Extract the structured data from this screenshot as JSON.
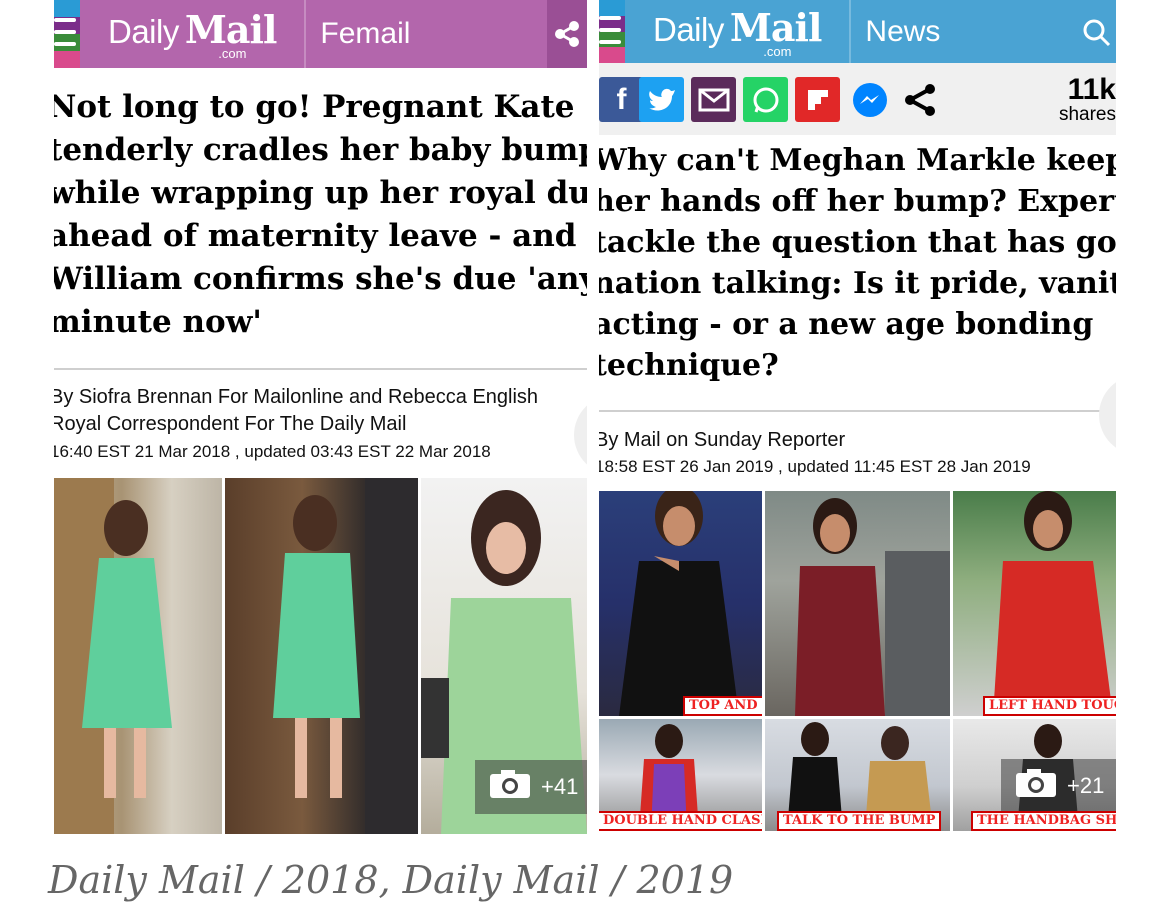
{
  "left": {
    "header": {
      "brand_daily": "Daily",
      "brand_mail": "Mail",
      "brand_com": ".com",
      "section": "Femail",
      "color": "#b366ac",
      "icon": "share-icon"
    },
    "headline_lines": [
      "Not long to go! Pregnant Kate",
      "tenderly cradles her baby bump",
      "while wrapping up her royal duties",
      "ahead of maternity leave - and",
      "William confirms she's due 'any",
      "minute now'"
    ],
    "byline_lines": [
      "By Siofra Brennan For Mailonline and Rebecca English",
      "Royal Correspondent For The Daily Mail"
    ],
    "date": "16:40 EST 21 Mar 2018 , updated 03:43 EST 22 Mar 2018",
    "photo_count": "+41"
  },
  "right": {
    "header": {
      "brand_daily": "Daily",
      "brand_mail": "Mail",
      "brand_com": ".com",
      "section": "News",
      "color": "#4aa3d3",
      "icon": "search-icon"
    },
    "share_buttons": [
      "facebook-icon",
      "twitter-icon",
      "email-icon",
      "whatsapp-icon",
      "flipboard-icon",
      "messenger-icon",
      "share-icon"
    ],
    "shares_count": "11k",
    "shares_label": "shares",
    "headline_lines": [
      "Why can't Meghan Markle keep",
      "her hands off her bump? Experts",
      "tackle the question that has got the",
      "nation talking: Is it pride, vanity,",
      "acting - or a new age bonding",
      "technique?"
    ],
    "byline_lines": [
      "By Mail on Sunday Reporter"
    ],
    "date": "18:58 EST 26 Jan 2019 , updated 11:45 EST 28 Jan 2019",
    "captions": {
      "top_toe": "TOP AND TOE HOLD",
      "left_hand": "LEFT HAND TOUCH",
      "double_hand": "DOUBLE HAND CLASP",
      "talk_bump": "TALK TO THE BUMP",
      "handbag": "THE HANDBAG SHIELD"
    },
    "photo_count": "+21"
  },
  "footer": "Daily Mail / 2018, Daily Mail / 2019"
}
